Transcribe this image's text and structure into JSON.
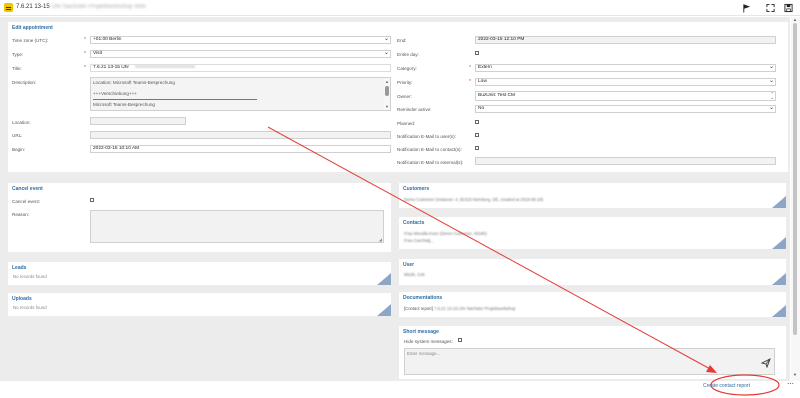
{
  "header": {
    "title_prefix": "7.6.21 13-15",
    "title_blurred": "Uhr Nächster Projektworkshop WBI",
    "icons": [
      "flag-icon",
      "expand-icon",
      "save-icon"
    ]
  },
  "appointment": {
    "section_title": "Edit appointment",
    "left": {
      "timezone_label": "Time zone (UTC):",
      "timezone_value": "+01:00 Berlin",
      "type_label": "Type:",
      "type_value": "Visit",
      "title_label": "Title:",
      "title_value": "7.6.21 13-15 Uhr",
      "description_label": "Description:",
      "description_lines": [
        "Location: Microsoft Teams-Besprechung",
        "+++Verschiebung+++",
        "Microsoft Teams-Besprechung"
      ],
      "location_label": "Location:",
      "url_label": "URL:",
      "begin_label": "Begin:",
      "begin_value": "2022-03-15 10:10 AM"
    },
    "right": {
      "end_label": "End:",
      "end_value": "2022-03-15 12:10 PM",
      "entire_day_label": "Entire day:",
      "category_label": "Category:",
      "category_value": "Extern",
      "priority_label": "Priority:",
      "priority_value": "Low",
      "owner_label": "Owner:",
      "owner_value": "BuzUnit: Test CM",
      "reminder_label": "Reminder active:",
      "reminder_value": "No",
      "planned_label": "Planned:",
      "notif_users_label": "Notification E-Mail to user(s):",
      "notif_contacts_label": "Notification E-Mail to contact(s):",
      "notif_external_label": "Notification E-Mail to external(s):"
    }
  },
  "cancel_event": {
    "title": "Cancel event",
    "cancel_label": "Cancel event:",
    "reason_label": "Reason:"
  },
  "leads": {
    "title": "Leads",
    "empty": "No records found"
  },
  "uploads": {
    "title": "Uploads",
    "empty": "No records found"
  },
  "customers": {
    "title": "Customers",
    "line": "Demo Customer (Instanze: 4, 82319 Nürnberg, DE, created at 2018-06-28)"
  },
  "contacts": {
    "title": "Contacts",
    "lines": [
      "Frau Wendla Konz (Demo Customer, 4534h)",
      "Frau Carchtalj, ,"
    ]
  },
  "user": {
    "title": "User",
    "line": "Müzik, Cek"
  },
  "documentations": {
    "title": "Documentations",
    "prefix": "[Contact report]",
    "line": "7.6.21 13-15 Uhr Nächster Projektworkshop"
  },
  "short_message": {
    "title": "Short message",
    "hide_label": "Hide system messages:",
    "placeholder": "Enter message..."
  },
  "footer": {
    "create_contact_report": "Create contact report"
  },
  "colors": {
    "accent": "#2e6da4",
    "annotation": "#e53935",
    "app_icon": "#f0c400"
  }
}
